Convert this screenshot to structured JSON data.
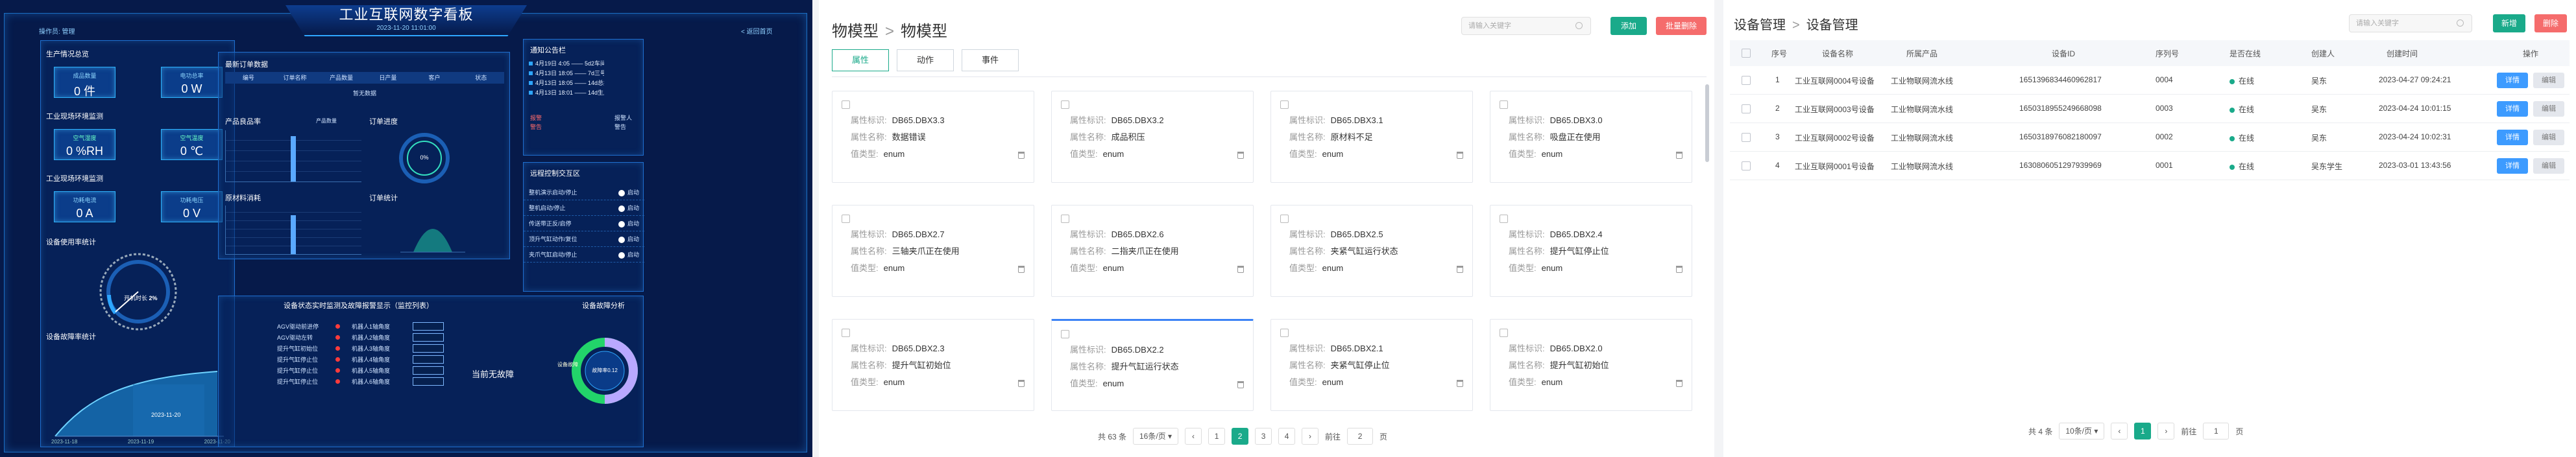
{
  "dashboard": {
    "title": "工业互联网数字看板",
    "datetime": "2023-11-20 11:01:00",
    "operator": "操作员: 管理",
    "back_btn": "< 返回首页",
    "production": {
      "title": "生产情况总览",
      "items": [
        {
          "label": "成品数量",
          "value": "0 件"
        },
        {
          "label": "电功总率",
          "value": "0 W"
        }
      ]
    },
    "env": {
      "title": "工业现场环境监测",
      "items": [
        {
          "label": "空气湿度",
          "value": "0 %RH"
        },
        {
          "label": "空气温度",
          "value": "0 ℃"
        }
      ]
    },
    "power": {
      "title": "工业现场环境监测",
      "items": [
        {
          "label": "功耗电流",
          "value": "0 A"
        },
        {
          "label": "功耗电压",
          "value": "0 V"
        }
      ]
    },
    "usage": {
      "title": "设备使用率统计",
      "gauge_label": "开机时长",
      "gauge_value": "2%"
    },
    "fault_stats": {
      "title": "设备故障率统计",
      "tooltip": "2023-11-20",
      "ticks": [
        "2023-11-18",
        "2023-11-19",
        "2023-11-20"
      ]
    },
    "orders": {
      "title": "最新订单数据",
      "headers": [
        "编号",
        "订单名称",
        "产品数量",
        "日产量",
        "客户",
        "状态"
      ],
      "empty": "暂无数据"
    },
    "sales": {
      "title": "产品良品率",
      "legend": "产品数量"
    },
    "progress": {
      "title": "订单进度",
      "value": "0%"
    },
    "materials": {
      "title": "原材料消耗"
    },
    "order_stats": {
      "title": "订单统计"
    },
    "notice": {
      "title": "通知公告栏",
      "items": [
        "4月19日 4:05 —— 5d2车间产线一小时维修排班",
        "4月13日 18:05 —— 7d三号发水线降低维修时间调...",
        "4月13日 18:05 —— 14d总控大屏维护",
        "4月13日 18:01 —— 14d生产车间维护"
      ],
      "tags": [
        "报警",
        "警告",
        "报警人",
        "警告"
      ]
    },
    "remote": {
      "title": "远程控制交互区",
      "rows": [
        {
          "label": "整机演示启动/停止",
          "state": "启动"
        },
        {
          "label": "整机启动/停止",
          "state": "启动"
        },
        {
          "label": "传送带正反/启停",
          "state": "启动"
        },
        {
          "label": "顶升气缸动作/复位",
          "state": "启动"
        },
        {
          "label": "夹爪气缸启动/停止",
          "state": "启动"
        }
      ]
    },
    "device_status": {
      "title": "设备状态实时监测及故障报警显示（监控列表）",
      "left": [
        "AGV驱动前进停",
        "AGV驱动左转",
        "提升气缸初始位",
        "提升气缸停止位",
        "提升气缸停止位",
        "提升气缸停止位"
      ],
      "right": [
        "机器人1轴角度",
        "机器人2轴角度",
        "机器人3轴角度",
        "机器人4轴角度",
        "机器人5轴角度",
        "机器人6轴角度"
      ],
      "no_fault": "当前无故障"
    },
    "fault_analysis": {
      "title": "设备故障分析",
      "center": "故障率0.12",
      "left_label": "设备故障"
    }
  },
  "thing_model": {
    "breadcrumb": [
      "物模型",
      "物模型"
    ],
    "search_placeholder": "请输入关键字",
    "add_btn": "添加",
    "batch_delete_btn": "批量删除",
    "tabs": [
      "属性",
      "动作",
      "事件"
    ],
    "field_labels": [
      "属性标识:",
      "属性名称:",
      "值类型:"
    ],
    "cards": [
      {
        "id": "DB65.DBX3.3",
        "name": "数据错误",
        "type": "enum"
      },
      {
        "id": "DB65.DBX3.2",
        "name": "成品积压",
        "type": "enum"
      },
      {
        "id": "DB65.DBX3.1",
        "name": "原材料不足",
        "type": "enum"
      },
      {
        "id": "DB65.DBX3.0",
        "name": "吸盘正在使用",
        "type": "enum"
      },
      {
        "id": "DB65.DBX2.7",
        "name": "三轴夹爪正在使用",
        "type": "enum"
      },
      {
        "id": "DB65.DBX2.6",
        "name": "二指夹爪正在使用",
        "type": "enum"
      },
      {
        "id": "DB65.DBX2.5",
        "name": "夹紧气缸运行状态",
        "type": "enum"
      },
      {
        "id": "DB65.DBX2.4",
        "name": "提升气缸停止位",
        "type": "enum"
      },
      {
        "id": "DB65.DBX2.3",
        "name": "提升气缸初始位",
        "type": "enum"
      },
      {
        "id": "DB65.DBX2.2",
        "name": "提升气缸运行状态",
        "type": "enum"
      },
      {
        "id": "DB65.DBX2.1",
        "name": "夹紧气缸停止位",
        "type": "enum"
      },
      {
        "id": "DB65.DBX2.0",
        "name": "提升气缸初始位",
        "type": "enum"
      }
    ],
    "pagination": {
      "total": "共 63 条",
      "page_size": "16条/页",
      "pages": [
        "1",
        "2",
        "3",
        "4"
      ],
      "current": "2",
      "goto_label": "前往",
      "goto_value": "2",
      "page_suffix": "页"
    }
  },
  "device_mgmt": {
    "breadcrumb": [
      "设备管理",
      "设备管理"
    ],
    "search_placeholder": "请输入关键字",
    "add_btn": "新增",
    "delete_btn": "删除",
    "headers": [
      "序号",
      "设备名称",
      "所属产品",
      "设备ID",
      "序列号",
      "是否在线",
      "创建人",
      "创建时间",
      "操作"
    ],
    "rows": [
      {
        "idx": "1",
        "name": "工业互联网0004号设备",
        "product": "工业物联网流水线",
        "id": "1651396834460962817",
        "sn": "0004",
        "online": "在线",
        "creator": "吴东",
        "time": "2023-04-27 09:24:21"
      },
      {
        "idx": "2",
        "name": "工业互联网0003号设备",
        "product": "工业物联网流水线",
        "id": "1650318955249668098",
        "sn": "0003",
        "online": "在线",
        "creator": "吴东",
        "time": "2023-04-24 10:01:15"
      },
      {
        "idx": "3",
        "name": "工业互联网0002号设备",
        "product": "工业物联网流水线",
        "id": "1650318976082180097",
        "sn": "0002",
        "online": "在线",
        "creator": "吴东",
        "time": "2023-04-24 10:02:31"
      },
      {
        "idx": "4",
        "name": "工业互联网0001号设备",
        "product": "工业物联网流水线",
        "id": "1630806051297939969",
        "sn": "0001",
        "online": "在线",
        "creator": "吴东学生",
        "time": "2023-03-01 13:43:56"
      }
    ],
    "detail_btn": "详情",
    "edit_btn": "编辑",
    "pagination": {
      "total": "共 4 条",
      "page_size": "10条/页",
      "current": "1",
      "goto_label": "前往",
      "goto_value": "1",
      "page_suffix": "页"
    }
  }
}
